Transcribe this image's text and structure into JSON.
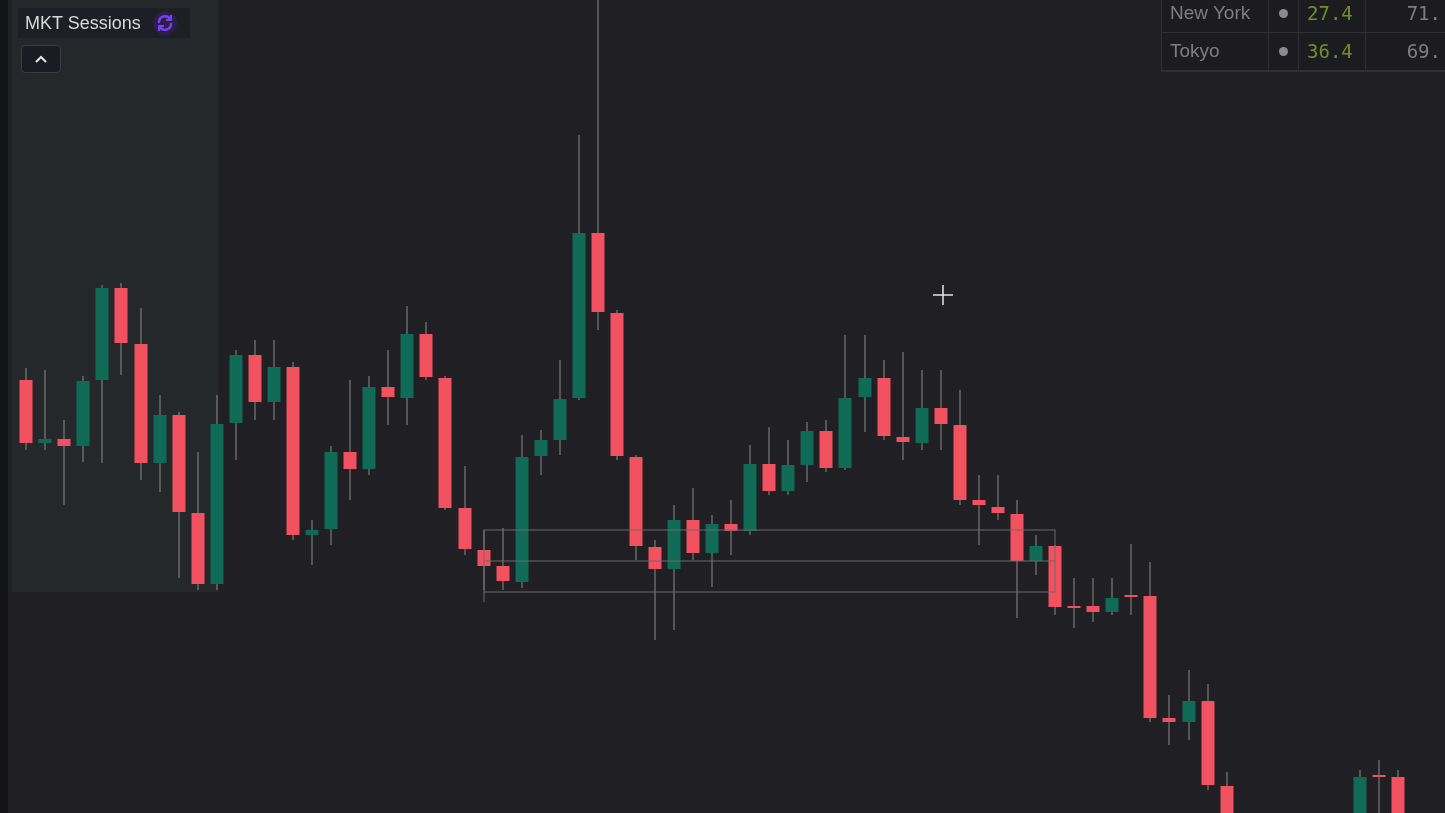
{
  "indicator": {
    "title": "MKT Sessions"
  },
  "sessions_table": {
    "rows": [
      {
        "name": "New York",
        "column_3": "27.4",
        "column_4": "71."
      },
      {
        "name": "Tokyo",
        "column_3": "36.4",
        "column_4": "69."
      }
    ]
  }
}
